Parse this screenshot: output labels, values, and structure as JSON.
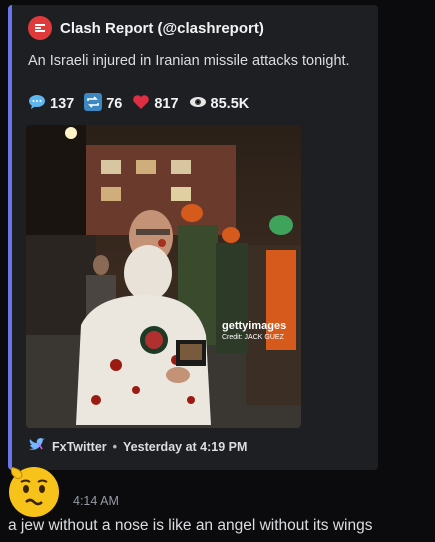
{
  "embed": {
    "accent_color": "#6b74e8",
    "author_name": "Clash Report (@clashreport)",
    "author_icon": "clash-report-logo",
    "description": "An Israeli injured in Iranian missile attacks tonight.",
    "stats": {
      "replies": "137",
      "retweets": "76",
      "likes": "817",
      "views": "85.5K"
    },
    "image": {
      "watermark_brand": "gettyimages",
      "credit": "Credit: JACK GUEZ"
    },
    "footer": {
      "source": "FxTwitter",
      "separator": "•",
      "time": "Yesterday at 4:19 PM"
    }
  },
  "message": {
    "avatar": "confused-emoji-avatar",
    "timestamp": "4:14 AM",
    "text": "a jew without a nose is like an angel without its wings"
  }
}
